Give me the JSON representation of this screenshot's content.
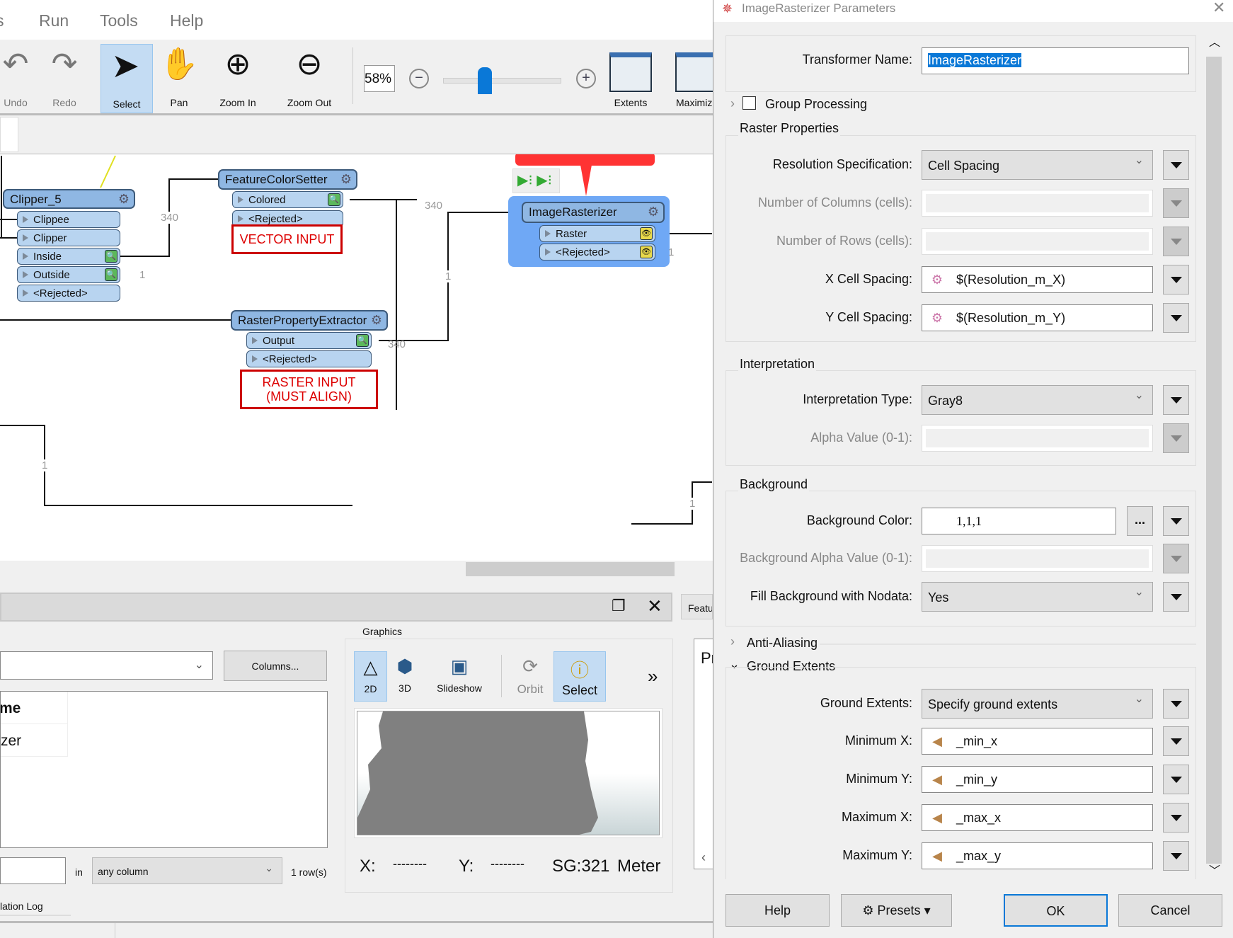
{
  "menu": [
    "s",
    "Run",
    "Tools",
    "Help"
  ],
  "toolbar": {
    "undo": "Undo",
    "redo": "Redo",
    "select": "Select",
    "pan": "Pan",
    "zoom_in": "Zoom In",
    "zoom_out": "Zoom Out",
    "zoom_value": "58%",
    "extents": "Extents",
    "maximize": "Maximiz"
  },
  "canvas": {
    "clipper": {
      "name": "Clipper_5",
      "ports": [
        "Clippee",
        "Clipper",
        "Inside",
        "Outside",
        "<Rejected>"
      ]
    },
    "fcs": {
      "name": "FeatureColorSetter",
      "ports": [
        "Colored",
        "<Rejected>"
      ]
    },
    "rpe": {
      "name": "RasterPropertyExtractor",
      "ports": [
        "Output",
        "<Rejected>"
      ]
    },
    "ir": {
      "name": "ImageRasterizer",
      "ports": [
        "Raster",
        "<Rejected>"
      ]
    },
    "notes": {
      "vector": "VECTOR INPUT",
      "raster_1": "RASTER INPUT",
      "raster_2": "(MUST ALIGN)"
    },
    "counts": {
      "inside": "340",
      "outside": "1",
      "colored": "340",
      "output": "340",
      "ir_in": "1",
      "ir_rej": "1",
      "bottom_left": "1",
      "bottom_right": "1"
    },
    "callout_color": "#ff3333",
    "selection_color": "#6fa8f5"
  },
  "panel": {
    "columns_button": "Columns...",
    "table": {
      "header": "me",
      "cell": "zer"
    },
    "in_label": "in",
    "search_scope": "any column",
    "row_count": "1 row(s)",
    "tab_right": "Featu",
    "tab_bottom": "lation Log"
  },
  "graphics": {
    "title": "Graphics",
    "buttons": [
      "2D",
      "3D",
      "Slideshow",
      "Orbit",
      "Select"
    ],
    "more": "»",
    "status": {
      "x_label": "X:",
      "x_value": "--------",
      "y_label": "Y:",
      "y_value": "--------",
      "crs": "SG:321",
      "units": "Meter"
    },
    "right_panel": "Pr"
  },
  "dialog": {
    "title": "ImageRasterizer Parameters",
    "transformer_name_label": "Transformer Name:",
    "transformer_name": "ImageRasterizer",
    "group_processing": "Group Processing",
    "raster_properties": "Raster Properties",
    "res_spec_label": "Resolution Specification:",
    "res_spec": "Cell Spacing",
    "num_cols_label": "Number of Columns (cells):",
    "num_rows_label": "Number of Rows (cells):",
    "x_spacing_label": "X Cell Spacing:",
    "x_spacing": "$(Resolution_m_X)",
    "y_spacing_label": "Y Cell Spacing:",
    "y_spacing": "$(Resolution_m_Y)",
    "interpretation": "Interpretation",
    "interp_type_label": "Interpretation Type:",
    "interp_type": "Gray8",
    "alpha_label": "Alpha Value (0-1):",
    "background": "Background",
    "bg_color_label": "Background Color:",
    "bg_color": "1,1,1",
    "ellipsis": "...",
    "bg_alpha_label": "Background Alpha Value (0-1):",
    "fill_nodata_label": "Fill Background with Nodata:",
    "fill_nodata": "Yes",
    "anti_aliasing": "Anti-Aliasing",
    "ground_extents": "Ground Extents",
    "ge_label": "Ground Extents:",
    "ge": "Specify ground extents",
    "min_x_label": "Minimum X:",
    "min_x": "_min_x",
    "min_y_label": "Minimum Y:",
    "min_y": "_min_y",
    "max_x_label": "Maximum X:",
    "max_x": "_max_x",
    "max_y_label": "Maximum Y:",
    "max_y": "_max_y",
    "help": "Help",
    "presets": "Presets",
    "ok": "OK",
    "cancel": "Cancel"
  }
}
